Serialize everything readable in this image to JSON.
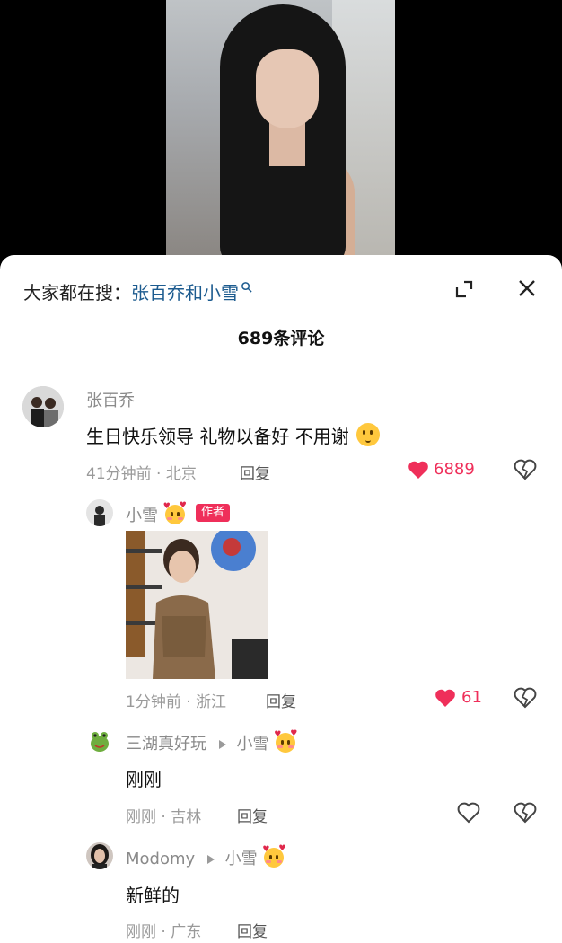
{
  "search": {
    "prefix": "大家都在搜：",
    "term": "张百乔和小雪"
  },
  "header": {
    "comment_count": "689条评论"
  },
  "comments": [
    {
      "username": "张百乔",
      "text": "生日快乐领导 礼物以备好 不用谢",
      "time_location": "41分钟前 · 北京",
      "reply_label": "回复",
      "likes": "6889",
      "liked": true
    }
  ],
  "replies": [
    {
      "username": "小雪",
      "badge": "作者",
      "time_location": "1分钟前 · 浙江",
      "reply_label": "回复",
      "likes": "61",
      "liked": true
    },
    {
      "username": "三湖真好玩",
      "reply_to": "小雪",
      "text": "刚刚",
      "time_location": "刚刚 · 吉林",
      "reply_label": "回复",
      "liked": false
    },
    {
      "username": "Modomy",
      "reply_to": "小雪",
      "text": "新鲜的",
      "time_location": "刚刚 · 广东",
      "reply_label": "回复",
      "liked": false
    }
  ],
  "colors": {
    "like_red": "#ef2f5a",
    "search_term": "#1c5b8f",
    "meta_gray": "#9a9a9a"
  },
  "icons": [
    "search-icon",
    "expand-icon",
    "close-icon",
    "heart-icon",
    "dislike-icon"
  ]
}
